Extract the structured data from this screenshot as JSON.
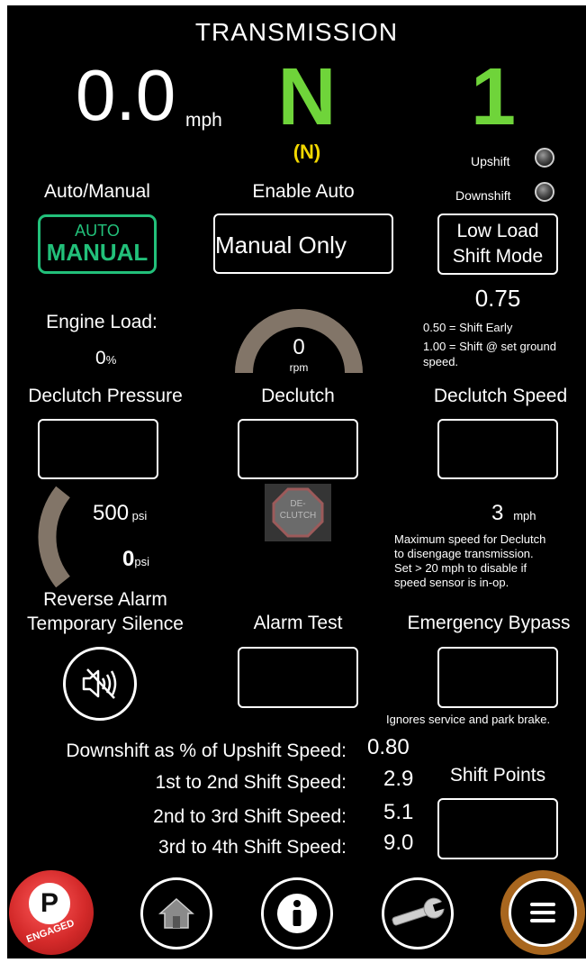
{
  "header": {
    "title": "TRANSMISSION"
  },
  "speed": {
    "value": "0.0",
    "unit": "mph"
  },
  "gear": {
    "selected": "N",
    "actual": "(N)",
    "range": "1"
  },
  "indicators": {
    "upshift": "Upshift",
    "downshift": "Downshift"
  },
  "auto_manual": {
    "label": "Auto/Manual",
    "auto_text": "AUTO",
    "manual_text": "MANUAL"
  },
  "enable_auto": {
    "label": "Enable Auto",
    "value": "Manual Only"
  },
  "low_load": {
    "line1": "Low Load",
    "line2": "Shift Mode",
    "value": "0.75",
    "note1": "0.50 = Shift Early",
    "note2": "1.00 = Shift @ set ground",
    "note3": "speed."
  },
  "engine_load": {
    "label": "Engine Load:",
    "value": "0",
    "unit": "%"
  },
  "rpm": {
    "value": "0",
    "unit": "rpm"
  },
  "declutch_pressure": {
    "label": "Declutch Pressure",
    "setpoint": "500",
    "setpoint_unit": "psi",
    "actual": "0",
    "actual_unit": "psi"
  },
  "declutch": {
    "label": "Declutch",
    "icon_line1": "DE-",
    "icon_line2": "CLUTCH"
  },
  "declutch_speed": {
    "label": "Declutch Speed",
    "value": "3",
    "unit": "mph",
    "note1": "Maximum speed for Declutch",
    "note2": "to disengage transmission.",
    "note3": "Set > 20 mph to disable if",
    "note4": "speed sensor is in-op."
  },
  "reverse_alarm": {
    "line1": "Reverse Alarm",
    "line2": "Temporary Silence"
  },
  "alarm_test": {
    "label": "Alarm Test"
  },
  "emergency_bypass": {
    "label": "Emergency Bypass",
    "note": "Ignores service and park brake."
  },
  "shift": {
    "downshift_pct_label": "Downshift as % of Upshift Speed:",
    "downshift_pct_value": "0.80",
    "s12_label": "1st to 2nd Shift Speed:",
    "s12_value": "2.9",
    "s23_label": "2nd to 3rd Shift Speed:",
    "s23_value": "5.1",
    "s34_label": "3rd to 4th Shift Speed:",
    "s34_value": "9.0",
    "points_label": "Shift Points"
  },
  "nav": {
    "park_letter": "P",
    "park_status": "ENGAGED"
  },
  "colors": {
    "gear_green": "#6fd43a",
    "gear_yellow": "#f2d800",
    "manual_green": "#22c07a",
    "park_red": "#d42a2a",
    "menu_ring": "#a8661e",
    "gauge_gray": "#827568"
  }
}
